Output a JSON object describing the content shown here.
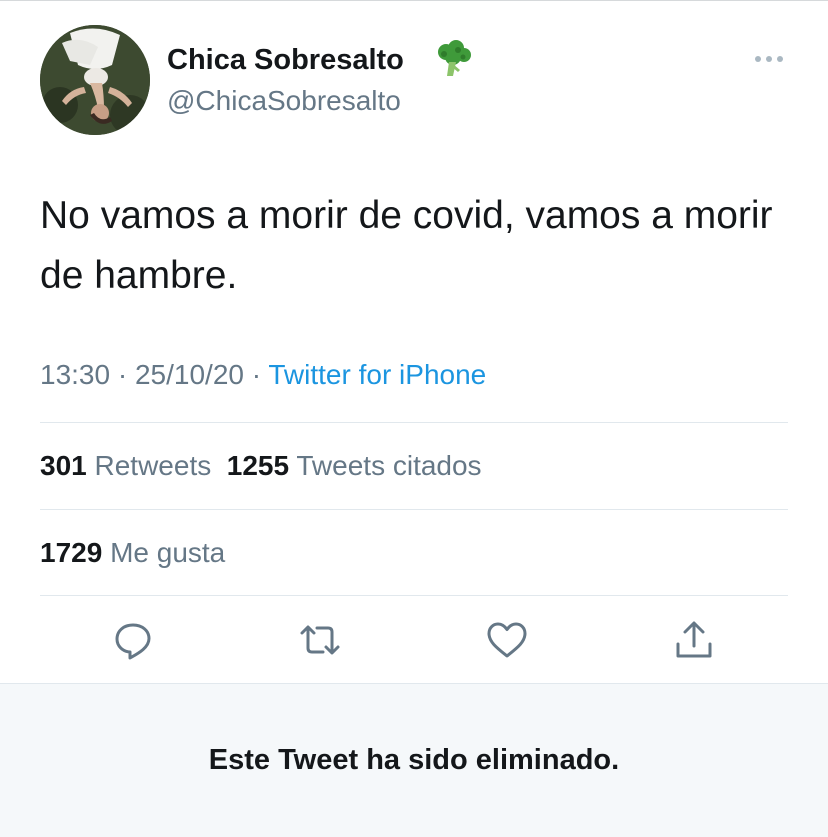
{
  "tweet": {
    "display_name": "Chica Sobresalto",
    "handle": "@ChicaSobresalto",
    "name_emoji": "broccoli-icon",
    "text": "No vamos a morir de covid, vamos a morir de hambre.",
    "time": "13:30",
    "date": "25/10/20",
    "separator": "·",
    "source": "Twitter for iPhone"
  },
  "stats": {
    "retweets_count": "301",
    "retweets_label": "Retweets",
    "quotes_count": "1255",
    "quotes_label": "Tweets citados",
    "likes_count": "1729",
    "likes_label": "Me gusta"
  },
  "actions": [
    "reply-icon",
    "retweet-icon",
    "like-icon",
    "share-icon"
  ],
  "banner": {
    "message": "Este Tweet ha sido eliminado."
  },
  "colors": {
    "text": "#14171a",
    "secondary": "#657786",
    "link": "#1b95e0",
    "divider": "#e1e8ed",
    "banner_bg": "#f5f8fa"
  }
}
